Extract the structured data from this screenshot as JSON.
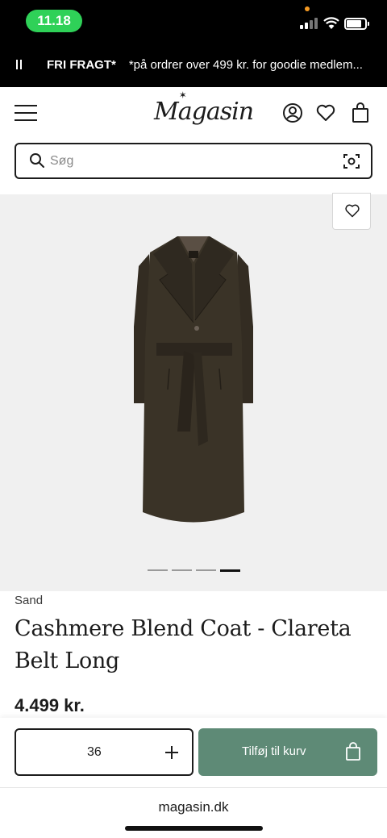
{
  "status": {
    "time": "11.18"
  },
  "promo": {
    "title": "FRI FRAGT*",
    "text": "*på ordrer over 499 kr. for goodie medlem..."
  },
  "header": {
    "logo": "Magasin"
  },
  "search": {
    "placeholder": "Søg"
  },
  "gallery": {
    "image_count": 4,
    "active_index": 3
  },
  "product": {
    "brand": "Sand",
    "title": "Cashmere Blend Coat - Clareta Belt Long",
    "price": "4.499 kr.",
    "image_alt": "Cashmere Blend Coat - Clareta Belt Long",
    "coat_color": "#3a3327"
  },
  "buy": {
    "size": "36",
    "add_label": "Tilføj til kurv",
    "button_color": "#5e8a76"
  },
  "browser": {
    "url": "magasin.dk"
  }
}
